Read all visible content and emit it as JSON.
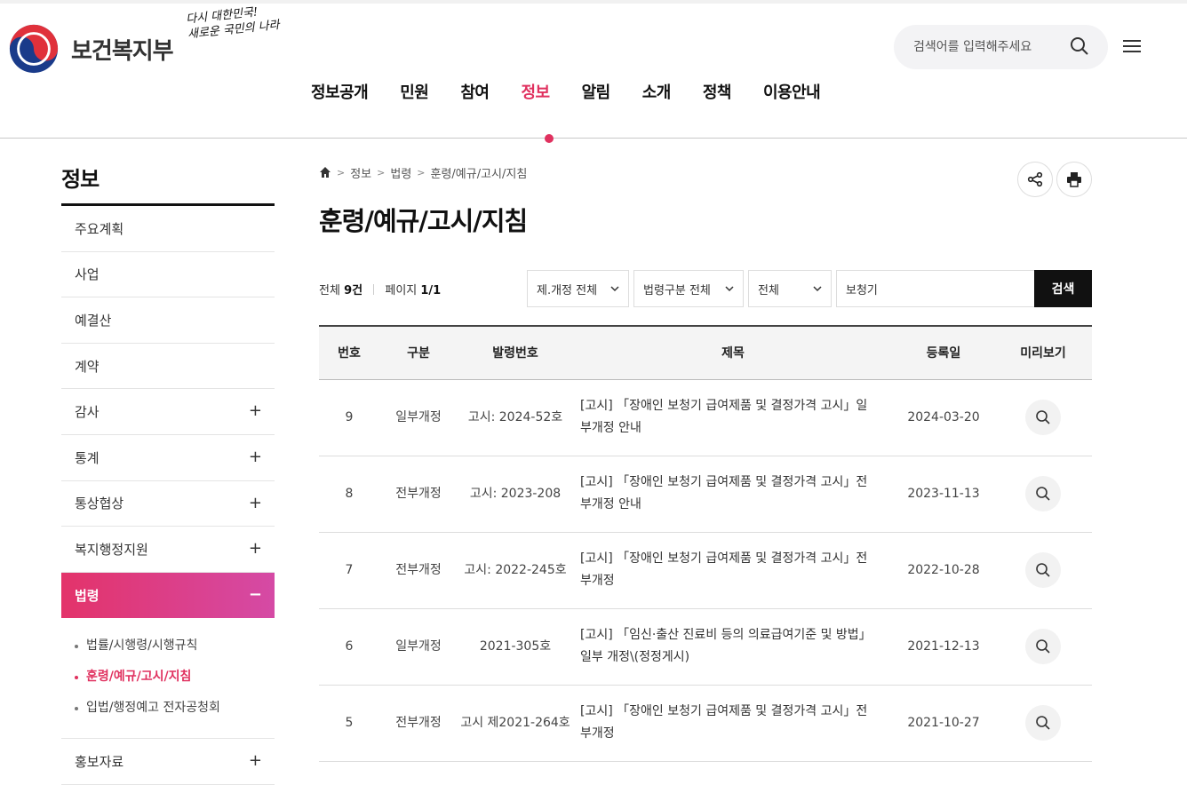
{
  "header": {
    "logo_text": "보건복지부",
    "slogan_line1": "다시 대한민국!",
    "slogan_line2": "새로운 국민의 나라",
    "search_placeholder": "검색어를 입력해주세요"
  },
  "gnb": [
    "정보공개",
    "민원",
    "참여",
    "정보",
    "알림",
    "소개",
    "정책",
    "이용안내"
  ],
  "gnb_active": "정보",
  "lnb": {
    "title": "정보",
    "items": [
      {
        "label": "주요계획",
        "plus": ""
      },
      {
        "label": "사업",
        "plus": ""
      },
      {
        "label": "예결산",
        "plus": ""
      },
      {
        "label": "계약",
        "plus": ""
      },
      {
        "label": "감사",
        "plus": "+"
      },
      {
        "label": "통계",
        "plus": "+"
      },
      {
        "label": "통상협상",
        "plus": "+"
      },
      {
        "label": "복지행정지원",
        "plus": "+"
      }
    ],
    "active": {
      "label": "법령",
      "minus": "−"
    },
    "sub": [
      "법률/시행령/시행규칙",
      "훈령/예규/고시/지침",
      "입법/행정예고 전자공청회"
    ],
    "after": {
      "label": "홍보자료",
      "plus": "+"
    }
  },
  "breadcrumb": [
    "정보",
    "법령",
    "훈령/예규/고시/지침"
  ],
  "page_title": "훈령/예규/고시/지침",
  "summary": {
    "total_label": "전체",
    "total_value": "9건",
    "page_label": "페이지",
    "page_value": "1/1"
  },
  "filters": {
    "revision": "제.개정 전체",
    "law_type": "법령구분 전체",
    "field": "전체",
    "keyword": "보청기",
    "search_button": "검색"
  },
  "table": {
    "headers": [
      "번호",
      "구분",
      "발령번호",
      "제목",
      "등록일",
      "미리보기"
    ],
    "rows": [
      {
        "no": "9",
        "type": "일부개정",
        "code": "고시: 2024-52호",
        "title": "[고시] 「장애인 보청기 급여제품 및 결정가격 고시」일부개정 안내",
        "date": "2024-03-20"
      },
      {
        "no": "8",
        "type": "전부개정",
        "code": "고시: 2023-208",
        "title": "[고시] 「장애인 보청기 급여제품 및 결정가격 고시」전부개정 안내",
        "date": "2023-11-13"
      },
      {
        "no": "7",
        "type": "전부개정",
        "code": "고시: 2022-245호",
        "title": "[고시] 「장애인 보청기 급여제품 및 결정가격 고시」전부개정",
        "date": "2022-10-28"
      },
      {
        "no": "6",
        "type": "일부개정",
        "code": "2021-305호",
        "title": "[고시] 「임신·출산 진료비 등의 의료급여기준 및 방법」 일부 개정\\(정정게시)",
        "date": "2021-12-13"
      },
      {
        "no": "5",
        "type": "전부개정",
        "code": "고시 제2021-264호",
        "title": "[고시] 「장애인 보청기 급여제품 및 결정가격 고시」전부개정",
        "date": "2021-10-27"
      }
    ]
  },
  "colors": {
    "accent": "#e0315f",
    "gradient_end": "#d54aa5"
  }
}
